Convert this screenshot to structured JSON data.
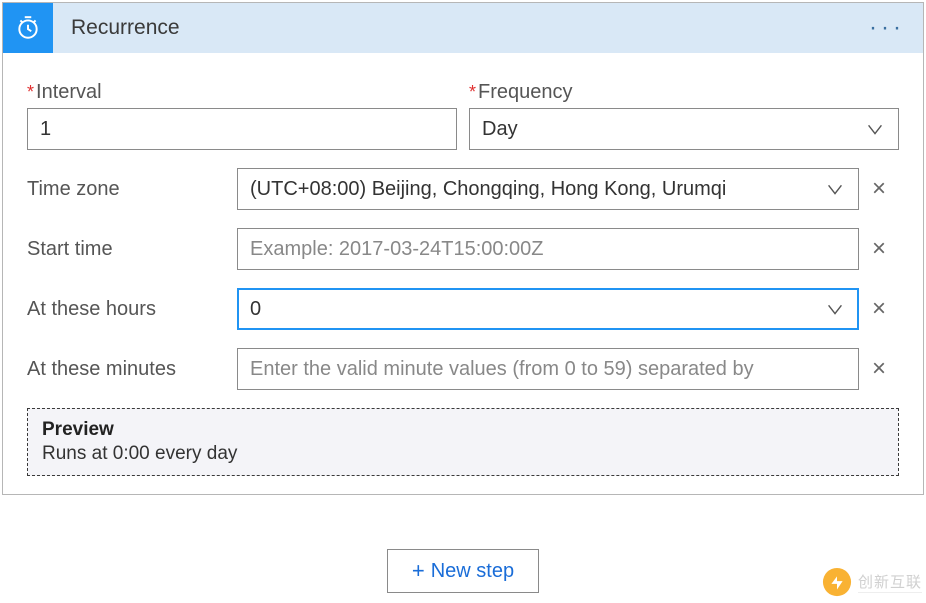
{
  "header": {
    "title": "Recurrence"
  },
  "fields": {
    "interval": {
      "label": "Interval",
      "value": "1"
    },
    "frequency": {
      "label": "Frequency",
      "value": "Day"
    },
    "timezone": {
      "label": "Time zone",
      "value": "(UTC+08:00) Beijing, Chongqing, Hong Kong, Urumqi"
    },
    "starttime": {
      "label": "Start time",
      "placeholder": "Example: 2017-03-24T15:00:00Z",
      "value": ""
    },
    "hours": {
      "label": "At these hours",
      "value": "0"
    },
    "minutes": {
      "label": "At these minutes",
      "placeholder": "Enter the valid minute values (from 0 to 59) separated by",
      "value": ""
    }
  },
  "preview": {
    "title": "Preview",
    "text": "Runs at 0:00 every day"
  },
  "actions": {
    "newStep": "New step"
  },
  "watermark": "创新互联"
}
